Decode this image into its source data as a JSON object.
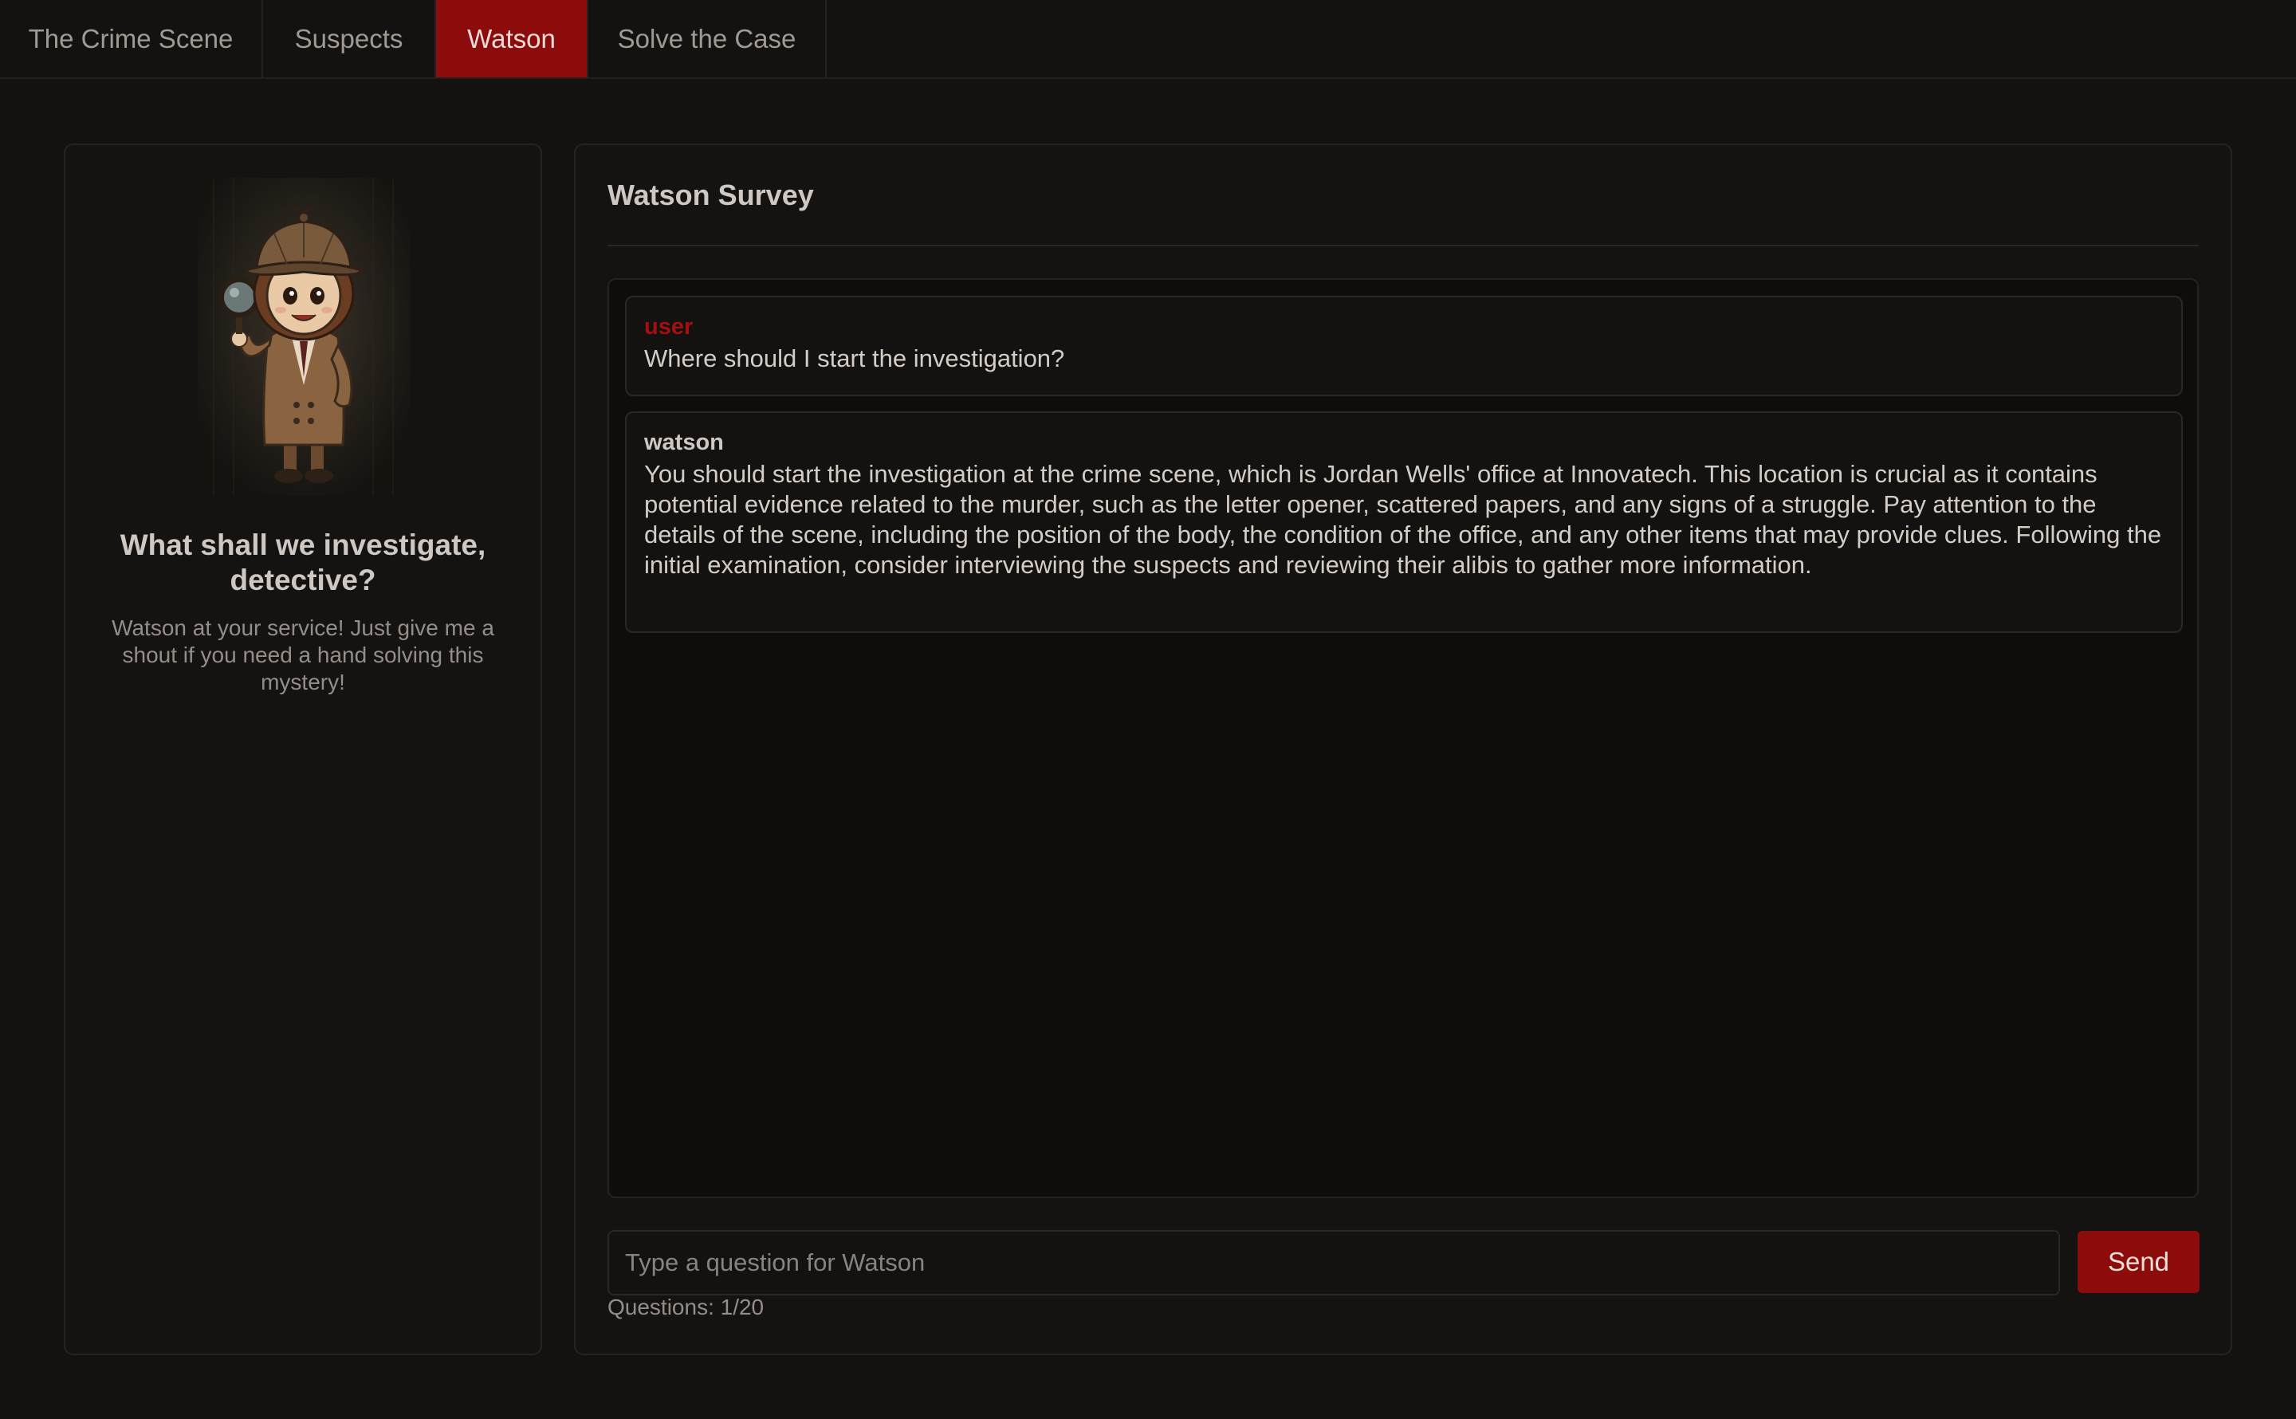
{
  "nav": {
    "tabs": [
      {
        "label": "The Crime Scene",
        "active": false
      },
      {
        "label": "Suspects",
        "active": false
      },
      {
        "label": "Watson",
        "active": true
      },
      {
        "label": "Solve the Case",
        "active": false
      }
    ]
  },
  "sidebar": {
    "portrait_icon": "detective-girl-portrait",
    "heading": "What shall we investigate, detective?",
    "subtext": "Watson at your service! Just give me a shout if you need a hand solving this mystery!"
  },
  "survey": {
    "title": "Watson Survey",
    "messages": [
      {
        "role": "user",
        "text": "Where should I start the investigation?"
      },
      {
        "role": "watson",
        "text": "You should start the investigation at the crime scene, which is Jordan Wells' office at Innovatech. This location is crucial as it contains potential evidence related to the murder, such as the letter opener, scattered papers, and any signs of a struggle. Pay attention to the details of the scene, including the position of the body, the condition of the office, and any other items that may provide clues. Following the initial examination, consider interviewing the suspects and reviewing their alibis to gather more information."
      }
    ],
    "input_placeholder": "Type a question for Watson",
    "input_value": "",
    "send_label": "Send",
    "counter": "Questions: 1/20"
  },
  "colors": {
    "accent": "#8c0b0b",
    "user_role": "#a50f0f",
    "background": "#141111"
  }
}
